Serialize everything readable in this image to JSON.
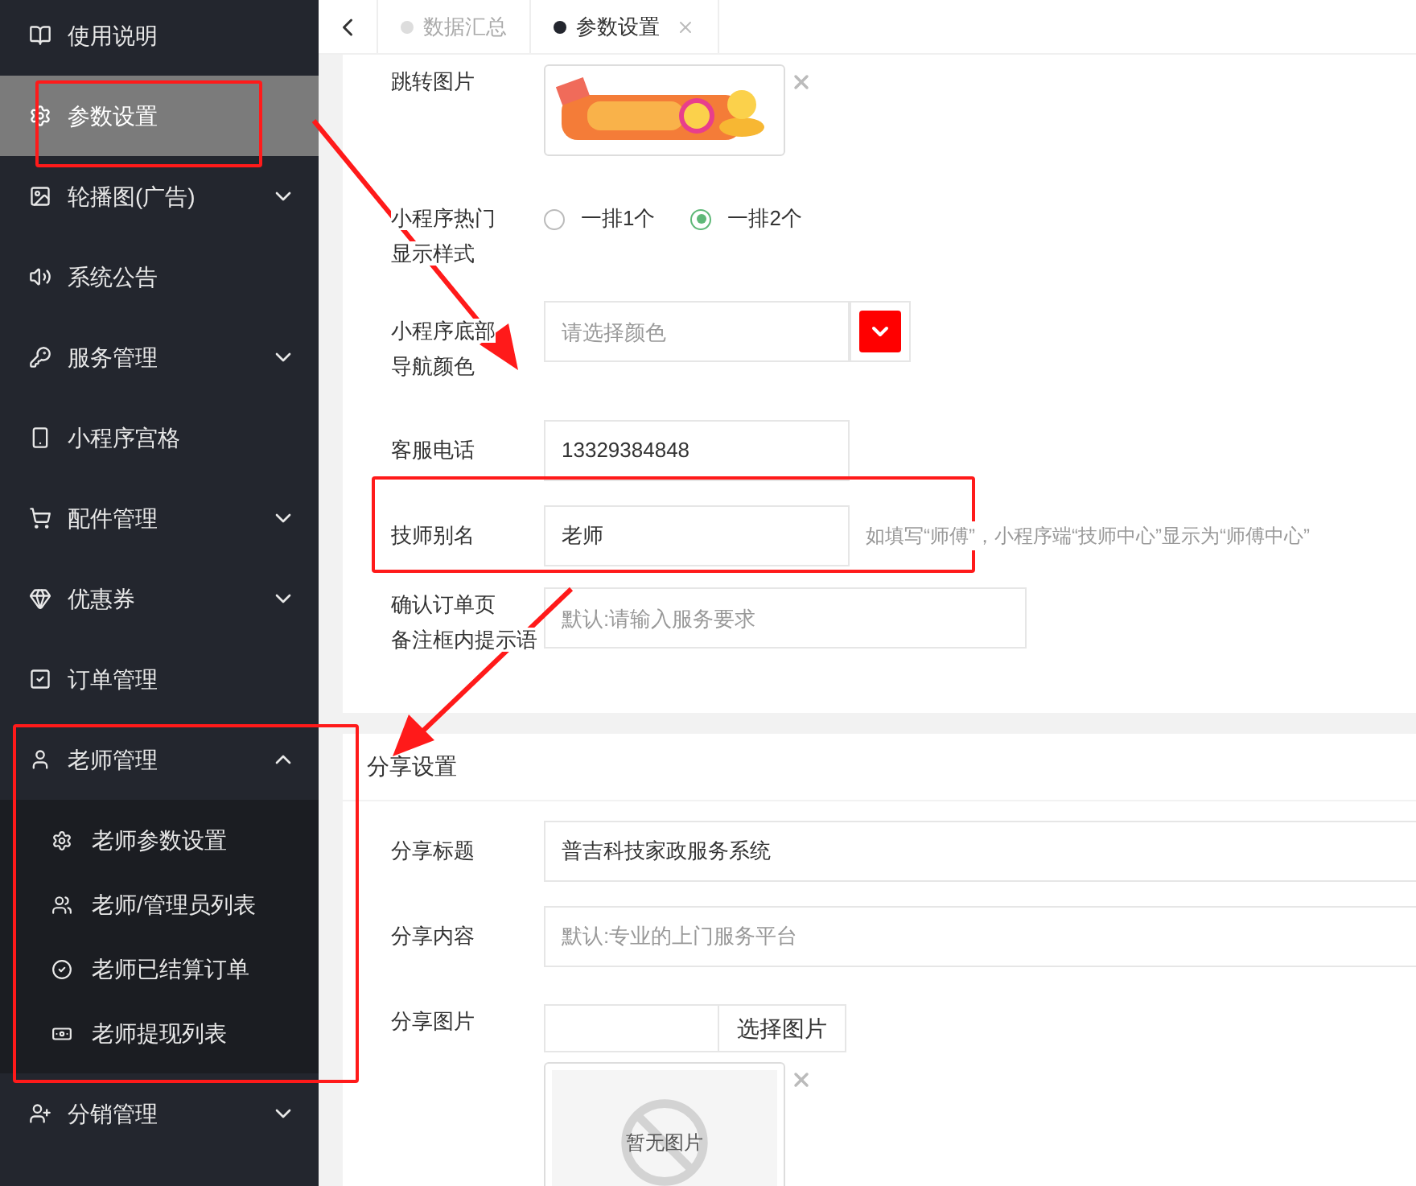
{
  "sidebar": {
    "items": [
      {
        "label": "使用说明",
        "kind": "link",
        "selected": false
      },
      {
        "label": "参数设置",
        "kind": "link",
        "selected": true
      },
      {
        "label": "轮播图(广告)",
        "kind": "group",
        "selected": false,
        "expanded": false
      },
      {
        "label": "系统公告",
        "kind": "link",
        "selected": false
      },
      {
        "label": "服务管理",
        "kind": "group",
        "selected": false,
        "expanded": false
      },
      {
        "label": "小程序宫格",
        "kind": "link",
        "selected": false
      },
      {
        "label": "配件管理",
        "kind": "group",
        "selected": false,
        "expanded": false
      },
      {
        "label": "优惠券",
        "kind": "group",
        "selected": false,
        "expanded": false
      },
      {
        "label": "订单管理",
        "kind": "link",
        "selected": false
      },
      {
        "label": "老师管理",
        "kind": "group",
        "selected": false,
        "expanded": true,
        "children": [
          {
            "label": "老师参数设置",
            "selected": false
          },
          {
            "label": "老师/管理员列表",
            "selected": false
          },
          {
            "label": "老师已结算订单",
            "selected": false
          },
          {
            "label": "老师提现列表",
            "selected": false
          }
        ]
      },
      {
        "label": "分销管理",
        "kind": "group",
        "selected": false,
        "expanded": false
      }
    ]
  },
  "tabs": [
    {
      "label": "数据汇总",
      "selected": false
    },
    {
      "label": "参数设置",
      "selected": true
    }
  ],
  "form": {
    "rows": [
      {
        "kind": "image",
        "label_lines": [
          "跳转图片"
        ]
      },
      {
        "kind": "radio",
        "label_lines": [
          "小程序热门",
          "显示样式"
        ],
        "options": [
          {
            "label": "一排1个",
            "selected": false
          },
          {
            "label": "一排2个",
            "selected": true
          }
        ]
      },
      {
        "kind": "color",
        "label_lines": [
          "小程序底部",
          "导航颜色"
        ],
        "placeholder": "请选择颜色",
        "color": "#ff0000"
      },
      {
        "kind": "text",
        "label_lines": [
          "客服电话"
        ],
        "value": "13329384848"
      },
      {
        "kind": "text",
        "label_lines": [
          "技师别名"
        ],
        "value": "老师",
        "hint": "如填写“师傅”，小程序端“技师中心”显示为“师傅中心”"
      },
      {
        "kind": "wide",
        "label_lines": [
          "确认订单页",
          "备注框内提示语"
        ],
        "placeholder": "默认:请输入服务要求"
      }
    ]
  },
  "share": {
    "title": "分享设置",
    "rows": [
      {
        "kind": "full",
        "label": "分享标题",
        "value": "普吉科技家政服务系统"
      },
      {
        "kind": "full",
        "label": "分享内容",
        "placeholder": "默认:专业的上门服务平台"
      },
      {
        "kind": "upload",
        "label": "分享图片",
        "button": "选择图片",
        "empty_text": "暂无图片"
      }
    ]
  }
}
